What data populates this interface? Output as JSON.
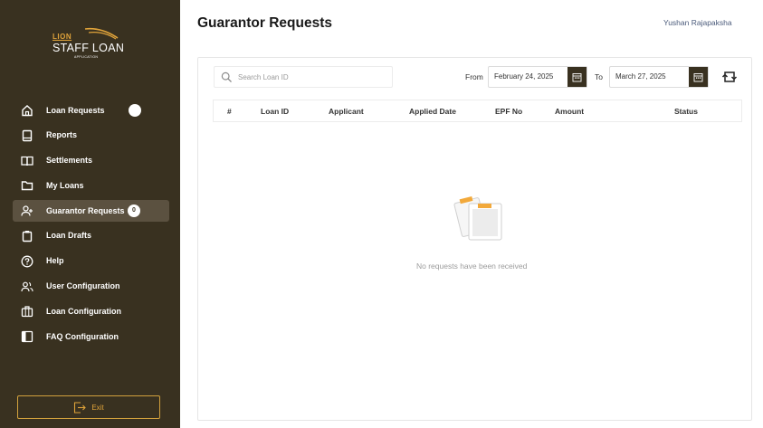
{
  "app": {
    "logo_brand": "LION",
    "logo_title": "STAFF LOAN",
    "logo_sub": "APPLICATION"
  },
  "sidebar": {
    "items": [
      {
        "label": "Loan Requests",
        "icon": "home-icon"
      },
      {
        "label": "Reports",
        "icon": "report-icon"
      },
      {
        "label": "Settlements",
        "icon": "book-icon"
      },
      {
        "label": "My Loans",
        "icon": "folder-icon"
      },
      {
        "label": "Guarantor Requests",
        "icon": "user-add-icon",
        "badge": "0"
      },
      {
        "label": "Loan Drafts",
        "icon": "clipboard-icon"
      },
      {
        "label": "Help",
        "icon": "help-icon"
      },
      {
        "label": "User Configuration",
        "icon": "users-icon"
      },
      {
        "label": "Loan Configuration",
        "icon": "briefcase-icon"
      },
      {
        "label": "FAQ Configuration",
        "icon": "sidebar-panel-icon"
      }
    ],
    "exit_label": "Exit"
  },
  "header": {
    "title": "Guarantor Requests",
    "user": "Yushan Rajapaksha"
  },
  "filters": {
    "search_placeholder": "Search Loan ID",
    "from_label": "From",
    "from_date": "February 24, 2025",
    "to_label": "To",
    "to_date": "March 27, 2025"
  },
  "table": {
    "columns": [
      "#",
      "Loan ID",
      "Applicant",
      "Applied Date",
      "EPF No",
      "Amount",
      "Status"
    ],
    "rows": []
  },
  "empty_state": {
    "message": "No requests have been received"
  },
  "colors": {
    "sidebar_bg": "#393120",
    "active_item_bg": "#5b5140",
    "accent": "#e0a33a"
  }
}
